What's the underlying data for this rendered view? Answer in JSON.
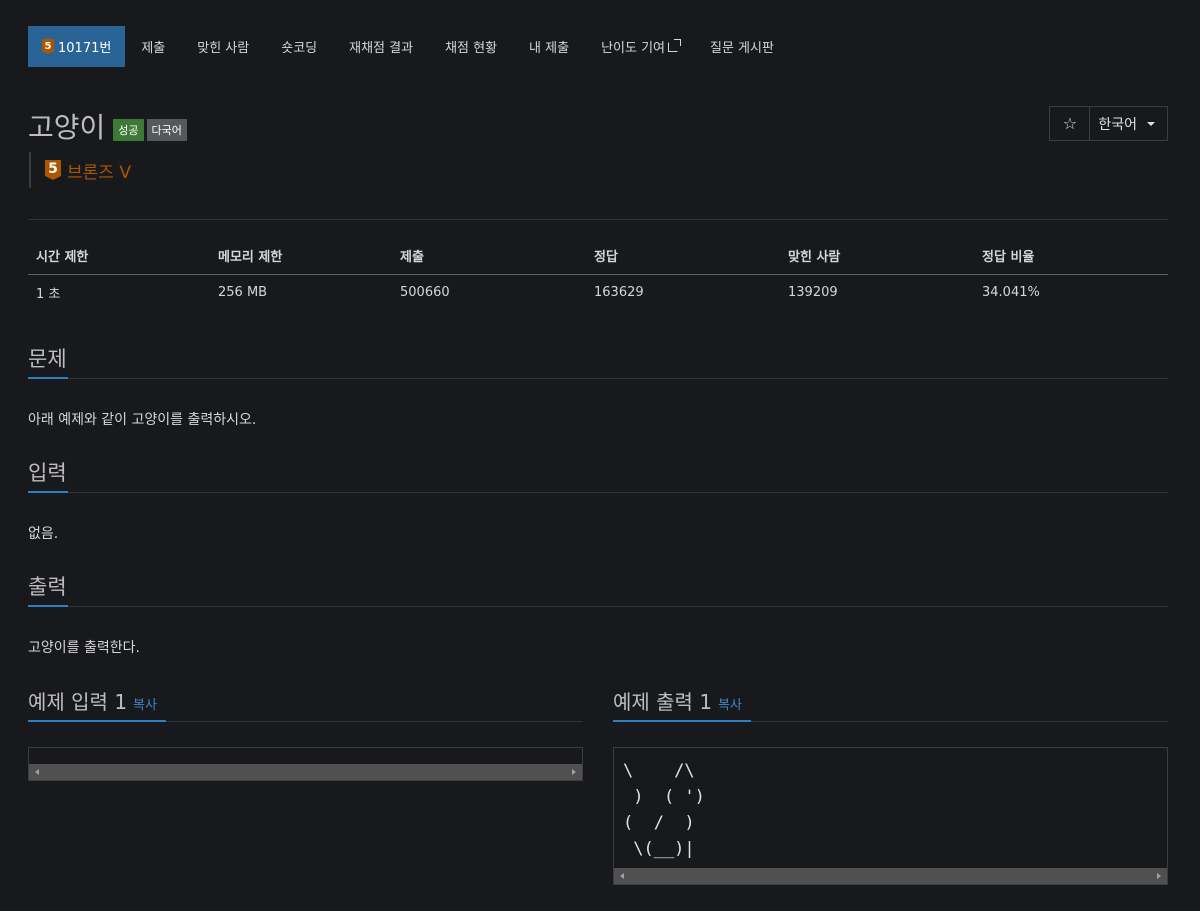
{
  "nav": {
    "problem_label": "10171번",
    "tier_num": "5",
    "items": [
      "제출",
      "맞힌 사람",
      "숏코딩",
      "재채점 결과",
      "채점 현황",
      "내 제출",
      "난이도 기여",
      "질문 게시판"
    ]
  },
  "problem": {
    "title": "고양이",
    "labels": [
      "성공",
      "다국어"
    ],
    "tier_num": "5",
    "tier_name": "브론즈 V",
    "tier_color": "#ad5600"
  },
  "buttons": {
    "star_icon": "star-icon",
    "language": "한국어"
  },
  "info_table": {
    "headers": [
      "시간 제한",
      "메모리 제한",
      "제출",
      "정답",
      "맞힌 사람",
      "정답 비율"
    ],
    "values": [
      "1 초",
      "256 MB",
      "500660",
      "163629",
      "139209",
      "34.041%"
    ]
  },
  "sections": {
    "problem_head": "문제",
    "problem_text": "아래 예제와 같이 고양이를 출력하시오.",
    "input_head": "입력",
    "input_text": "없음.",
    "output_head": "출력",
    "output_text": "고양이를 출력한다."
  },
  "examples": {
    "input_title": "예제 입력 1",
    "output_title": "예제 출력 1",
    "copy": "복사",
    "input_value": "",
    "output_lines": [
      "\\    /\\",
      " )  ( ')",
      "(  /  )",
      " \\(__)|"
    ]
  }
}
